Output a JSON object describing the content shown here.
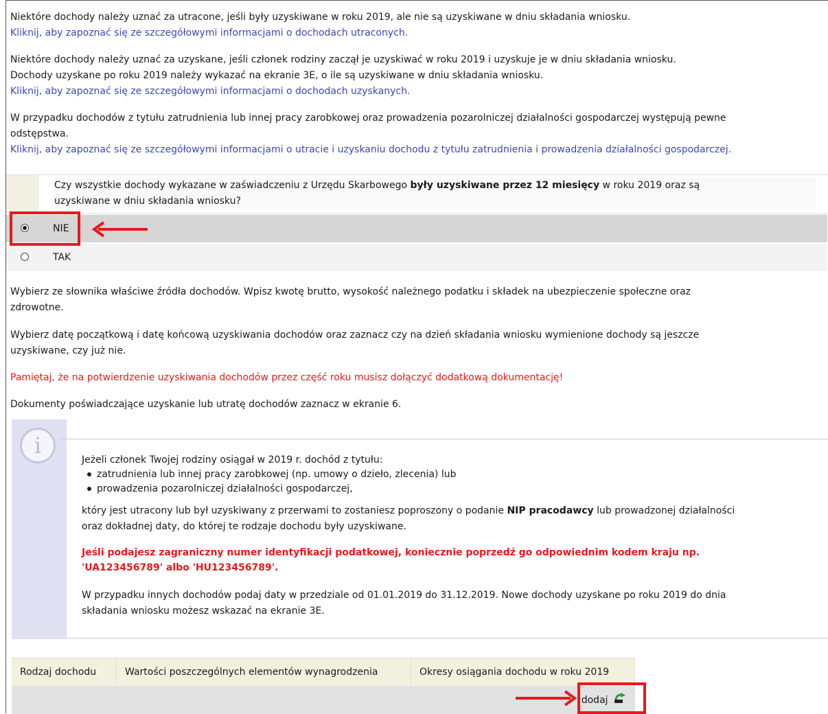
{
  "intro": {
    "p1_text": "Niektóre dochody należy uznać za utracone, jeśli były uzyskiwane w roku 2019, ale nie są uzyskiwane w dniu składania wniosku.",
    "p1_link": "Kliknij, aby zapoznać się ze szczegółowymi informacjami o dochodach utraconych.",
    "p2_line1": "Niektóre dochody należy uznać za uzyskane, jeśli członek rodziny zaczął je uzyskiwać w roku 2019 i uzyskuje je w dniu składania wniosku.",
    "p2_line2": "Dochody uzyskane po roku 2019 należy wykazać na ekranie 3E, o ile są uzyskiwane w dniu składania wniosku.",
    "p2_link": "Kliknij, aby zapoznać się ze szczegółowymi informacjami o dochodach uzyskanych.",
    "p3_line1": "W przypadku dochodów z tytułu zatrudnienia lub innej pracy zarobkowej oraz prowadzenia pozarolniczej działalności gospodarczej występują pewne",
    "p3_line2": "odstępstwa.",
    "p3_link": "Kliknij, aby zapoznać się ze szczegółowymi informacjami o utracie i uzyskaniu dochodu z tytułu zatrudnienia i prowadzenia działalności gospodarczej."
  },
  "question": {
    "text_before": "Czy wszystkie dochody wykazane w zaświadczeniu z Urzędu Skarbowego ",
    "text_bold": "były uzyskiwane przez 12 miesięcy",
    "text_after": " w roku 2019 oraz są",
    "text_line2": "uzyskiwane w dniu składania wniosku?",
    "options": [
      {
        "label": "NIE",
        "selected": true
      },
      {
        "label": "TAK",
        "selected": false
      }
    ]
  },
  "instructions": {
    "p1_line1": "Wybierz ze słownika właściwe źródła dochodów. Wpisz kwotę brutto, wysokość należnego podatku i składek na ubezpieczenie społeczne oraz",
    "p1_line2": "zdrowotne.",
    "p2_line1": "Wybierz datę początkową i datę końcową uzyskiwania dochodów oraz zaznacz czy na dzień składania wniosku wymienione dochody są jeszcze",
    "p2_line2": "uzyskiwane, czy już nie.",
    "warning": "Pamiętaj, że na potwierdzenie uzyskiwania dochodów przez część roku musisz dołączyć dodatkową dokumentację!",
    "p3": "Dokumenty poświadczające uzyskanie lub utratę dochodów zaznacz w ekranie 6."
  },
  "info": {
    "icon_glyph": "i",
    "intro": "Jeżeli członek Twojej rodziny osiągał w 2019 r. dochód z tytułu:",
    "bullets": [
      "zatrudnienia lub innej pracy zarobkowej (np. umowy o dzieło, zlecenia) lub",
      "prowadzenia pozarolniczej działalności gospodarczej,"
    ],
    "p2_line1_before": "który jest utracony lub był uzyskiwany z przerwami to zostaniesz poproszony o podanie ",
    "p2_line1_bold": "NIP pracodawcy",
    "p2_line1_after": " lub prowadzonej działalności",
    "p2_line2": "oraz dokładnej daty, do której te rodzaje dochodu były uzyskiwane.",
    "warn_line1": "Jeśli podajesz zagraniczny numer identyfikacji podatkowej, koniecznie poprzedź go odpowiednim kodem kraju np.",
    "warn_line2": "'UA123456789' albo 'HU123456789'.",
    "p3_line1": "W przypadku innych dochodów podaj daty w przedziale od 01.01.2019 do 31.12.2019. Nowe dochody uzyskane po roku 2019 do dnia",
    "p3_line2": "składania wniosku możesz wskazać na ekranie 3E."
  },
  "table": {
    "columns": [
      "Rodzaj dochodu",
      "Wartości poszczególnych elementów wynagrodzenia",
      "Okresy osiągania dochodu w roku 2019"
    ],
    "add_label": "dodaj"
  },
  "colors": {
    "highlight_red": "#e8181b",
    "link_blue": "#3b47b8",
    "warning_red": "#e31b1b"
  }
}
